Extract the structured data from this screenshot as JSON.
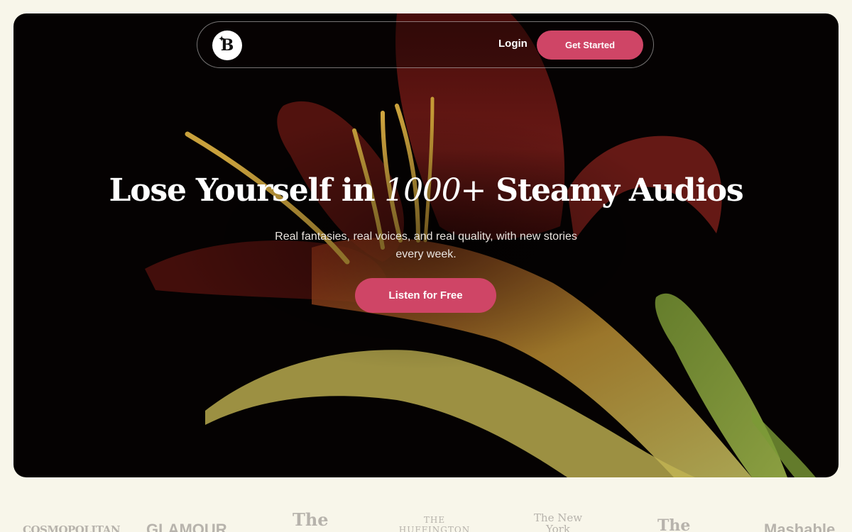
{
  "nav": {
    "logo_letter": "B",
    "login_label": "Login",
    "get_started_label": "Get Started"
  },
  "hero": {
    "headline_prefix": "Lose Yourself in ",
    "headline_number": "1000+",
    "headline_suffix": " Steamy Audios",
    "subtitle": "Real fantasies, real voices, and real quality, with new stories every week.",
    "cta_label": "Listen for Free",
    "image_description_colors": {
      "petal": "#6e1a16",
      "petal_dark": "#3a0a08",
      "stamen": "#c9a13c",
      "stem": "#9aa03a",
      "bud": "#7d9a3a"
    }
  },
  "press": {
    "logos": [
      "COSMOPOLITAN",
      "GLAMOUR",
      "The",
      "THE HUFFINGTON",
      "The New York",
      "The",
      "Mashable"
    ]
  },
  "colors": {
    "page_background": "#f8f6ea",
    "accent": "#cf4566",
    "hero_background": "#050202"
  }
}
